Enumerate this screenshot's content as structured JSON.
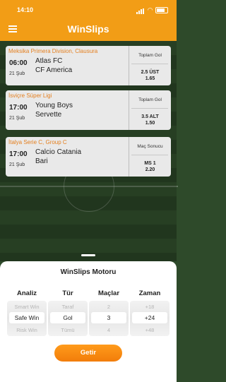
{
  "status": {
    "time": "14:10"
  },
  "header": {
    "title": "WinSlips"
  },
  "matches": [
    {
      "league": "Meksika Primera Division, Clausura",
      "time": "06:00",
      "date": "21 Şub",
      "home": "Atlas FC",
      "away": "CF America",
      "market": "Toplam Gol",
      "pick": "2.5 ÜST",
      "odd": "1.65"
    },
    {
      "league": "İsviçre Süper Ligi",
      "time": "17:00",
      "date": "21 Şub",
      "home": "Young Boys",
      "away": "Servette",
      "market": "Toplam Gol",
      "pick": "3.5 ALT",
      "odd": "1.50"
    },
    {
      "league": "İtalya Serie C, Group C",
      "time": "17:00",
      "date": "21 Şub",
      "home": "Calcio Catania",
      "away": "Bari",
      "market": "Maç Sonucu",
      "pick": "MS 1",
      "odd": "2.20"
    }
  ],
  "sheet": {
    "title": "WinSlips Motoru",
    "columns": [
      {
        "header": "Analiz",
        "prev": "Smart Win",
        "selected": "Safe Win",
        "next": "Risk Win"
      },
      {
        "header": "Tür",
        "prev": "Taraf",
        "selected": "Gol",
        "next": "Tümü"
      },
      {
        "header": "Maçlar",
        "prev": "2",
        "selected": "3",
        "next": "4"
      },
      {
        "header": "Zaman",
        "prev": "+18",
        "selected": "+24",
        "next": "+48"
      }
    ],
    "button_label": "Getir"
  },
  "colors": {
    "accent": "#f29d16",
    "league_text": "#e47f1e"
  }
}
